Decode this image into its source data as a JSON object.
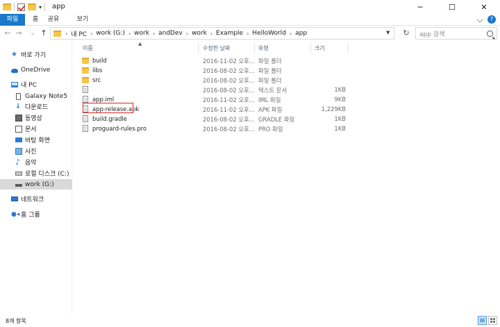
{
  "window": {
    "title": "app",
    "controls": [
      "─",
      "☐",
      "✕"
    ]
  },
  "ribbon": {
    "tabs": [
      "파일",
      "홈",
      "공유",
      "보기"
    ]
  },
  "nav": {
    "back": "←",
    "forward": "→",
    "recent": "⌄",
    "up": "↑"
  },
  "address": {
    "crumbs": [
      "내 PC",
      "work (G:)",
      "work",
      "andDev",
      "work",
      "Example",
      "HelloWorld",
      "app"
    ],
    "search_placeholder": "app 검색"
  },
  "sidebar": {
    "items": [
      {
        "label": "바로 가기",
        "icon": "star-icon"
      },
      {
        "label": "OneDrive",
        "icon": "cloud-icon"
      },
      {
        "label": "내 PC",
        "icon": "pc-icon"
      },
      {
        "label": "Galaxy Note5",
        "icon": "phone-icon"
      },
      {
        "label": "다운로드",
        "icon": "download-icon"
      },
      {
        "label": "동영상",
        "icon": "video-icon"
      },
      {
        "label": "문서",
        "icon": "document-icon"
      },
      {
        "label": "바탕 화면",
        "icon": "desktop-icon"
      },
      {
        "label": "사진",
        "icon": "pictures-icon"
      },
      {
        "label": "음악",
        "icon": "music-icon"
      },
      {
        "label": "로컬 디스크 (C:)",
        "icon": "local-disk-icon"
      },
      {
        "label": "work (G:)",
        "icon": "drive-icon",
        "selected": true
      },
      {
        "label": "네트워크",
        "icon": "network-icon"
      },
      {
        "label": "홈 그룹",
        "icon": "homegroup-icon"
      }
    ]
  },
  "columns": [
    "이름",
    "수정한 날짜",
    "유형",
    "크기"
  ],
  "files": [
    {
      "name": "build",
      "date": "2016-11-02 오후...",
      "type": "파일 폴더",
      "size": "",
      "kind": "folder"
    },
    {
      "name": "libs",
      "date": "2016-08-02 오후...",
      "type": "파일 폴더",
      "size": "",
      "kind": "folder"
    },
    {
      "name": "src",
      "date": "2016-08-02 오후...",
      "type": "파일 폴더",
      "size": "",
      "kind": "folder"
    },
    {
      "name": "",
      "date": "2016-08-02 오후...",
      "type": "텍스트 문서",
      "size": "1KB",
      "kind": "file"
    },
    {
      "name": "app.iml",
      "date": "2016-11-02 오후...",
      "type": "IML 파일",
      "size": "9KB",
      "kind": "file"
    },
    {
      "name": "app-release.apk",
      "date": "2016-11-02 오후...",
      "type": "APK 파일",
      "size": "1,229KB",
      "kind": "file",
      "highlighted": true
    },
    {
      "name": "build.gradle",
      "date": "2016-08-02 오후...",
      "type": "GRADLE 파일",
      "size": "1KB",
      "kind": "file"
    },
    {
      "name": "proguard-rules.pro",
      "date": "2016-08-02 오후...",
      "type": "PRO 파일",
      "size": "1KB",
      "kind": "file"
    }
  ],
  "status": {
    "item_count": "8개 항목"
  },
  "colors": {
    "accent": "#1979ca",
    "highlight_box": "#d9241f",
    "selection": "#d9d9d9"
  }
}
